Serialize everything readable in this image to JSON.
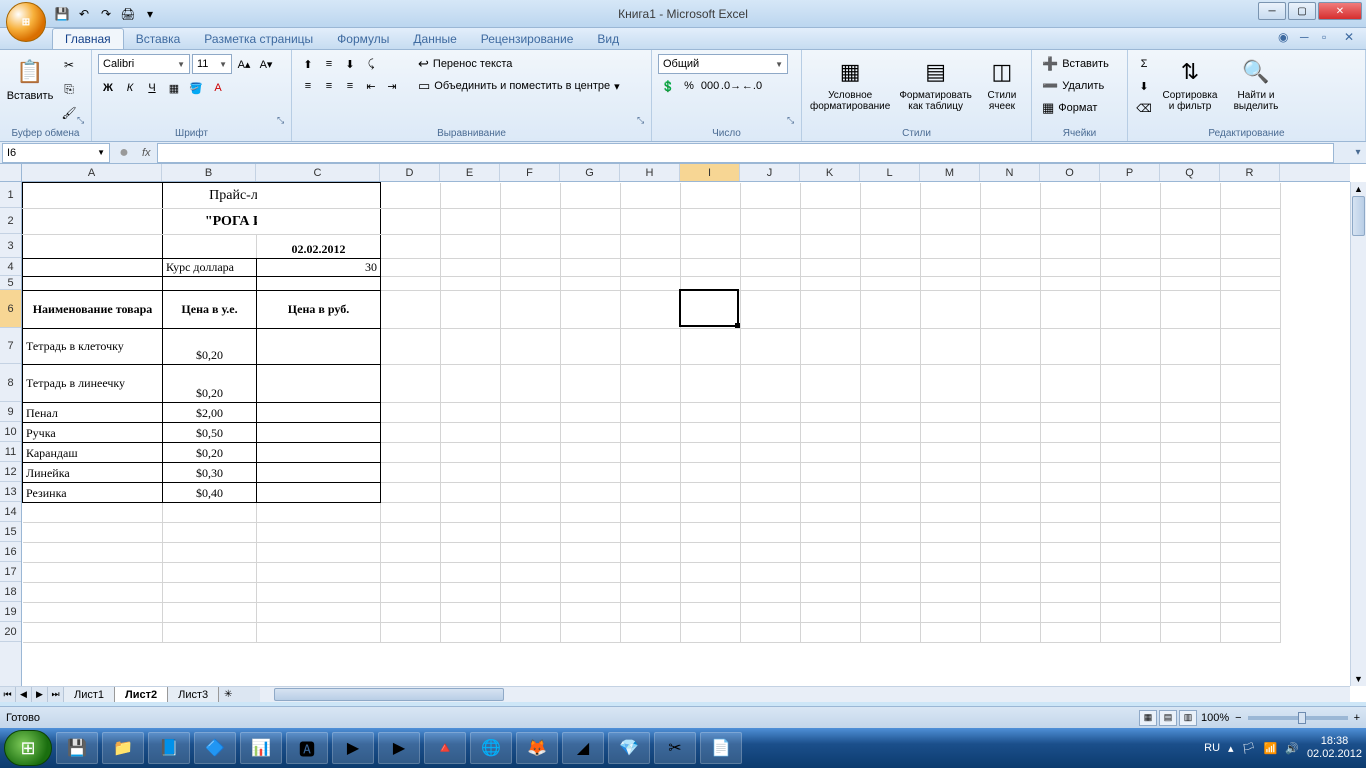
{
  "window": {
    "title": "Книга1 - Microsoft Excel"
  },
  "tabs": {
    "t1": "Главная",
    "t2": "Вставка",
    "t3": "Разметка страницы",
    "t4": "Формулы",
    "t5": "Данные",
    "t6": "Рецензирование",
    "t7": "Вид"
  },
  "ribbon": {
    "clipboard": {
      "paste": "Вставить",
      "label": "Буфер обмена"
    },
    "font": {
      "name": "Calibri",
      "size": "11",
      "label": "Шрифт"
    },
    "alignment": {
      "wrap": "Перенос текста",
      "merge": "Объединить и поместить в центре",
      "label": "Выравнивание"
    },
    "number": {
      "format": "Общий",
      "label": "Число"
    },
    "styles": {
      "cond": "Условное форматирование",
      "table": "Форматировать как таблицу",
      "cell": "Стили ячеек",
      "label": "Стили"
    },
    "cells": {
      "insert": "Вставить",
      "delete": "Удалить",
      "format": "Формат",
      "label": "Ячейки"
    },
    "editing": {
      "sort": "Сортировка и фильтр",
      "find": "Найти и выделить",
      "label": "Редактирование"
    }
  },
  "namebox": "I6",
  "sheet": {
    "title": "Прайс-лист магазина",
    "subtitle": "\"РОГА И КОПЫТА\"",
    "date": "02.02.2012",
    "rate_label": "Курс доллара",
    "rate_value": "30",
    "hdr_name": "Наименование товара",
    "hdr_usd": "Цена в у.е.",
    "hdr_rub": "Цена в руб.",
    "rows": [
      {
        "n": "Тетрадь в клеточку",
        "p": "$0,20"
      },
      {
        "n": "Тетрадь в линеечку",
        "p": "$0,20"
      },
      {
        "n": "Пенал",
        "p": "$2,00"
      },
      {
        "n": "Ручка",
        "p": "$0,50"
      },
      {
        "n": "Карандаш",
        "p": "$0,20"
      },
      {
        "n": "Линейка",
        "p": "$0,30"
      },
      {
        "n": "Резинка",
        "p": "$0,40"
      }
    ]
  },
  "cols": [
    "A",
    "B",
    "C",
    "D",
    "E",
    "F",
    "G",
    "H",
    "I",
    "J",
    "K",
    "L",
    "M",
    "N",
    "O",
    "P",
    "Q",
    "R"
  ],
  "sheets": {
    "s1": "Лист1",
    "s2": "Лист2",
    "s3": "Лист3"
  },
  "status": {
    "ready": "Готово",
    "zoom": "100%"
  },
  "taskbar": {
    "lang": "RU",
    "time": "18:38",
    "date": "02.02.2012"
  }
}
